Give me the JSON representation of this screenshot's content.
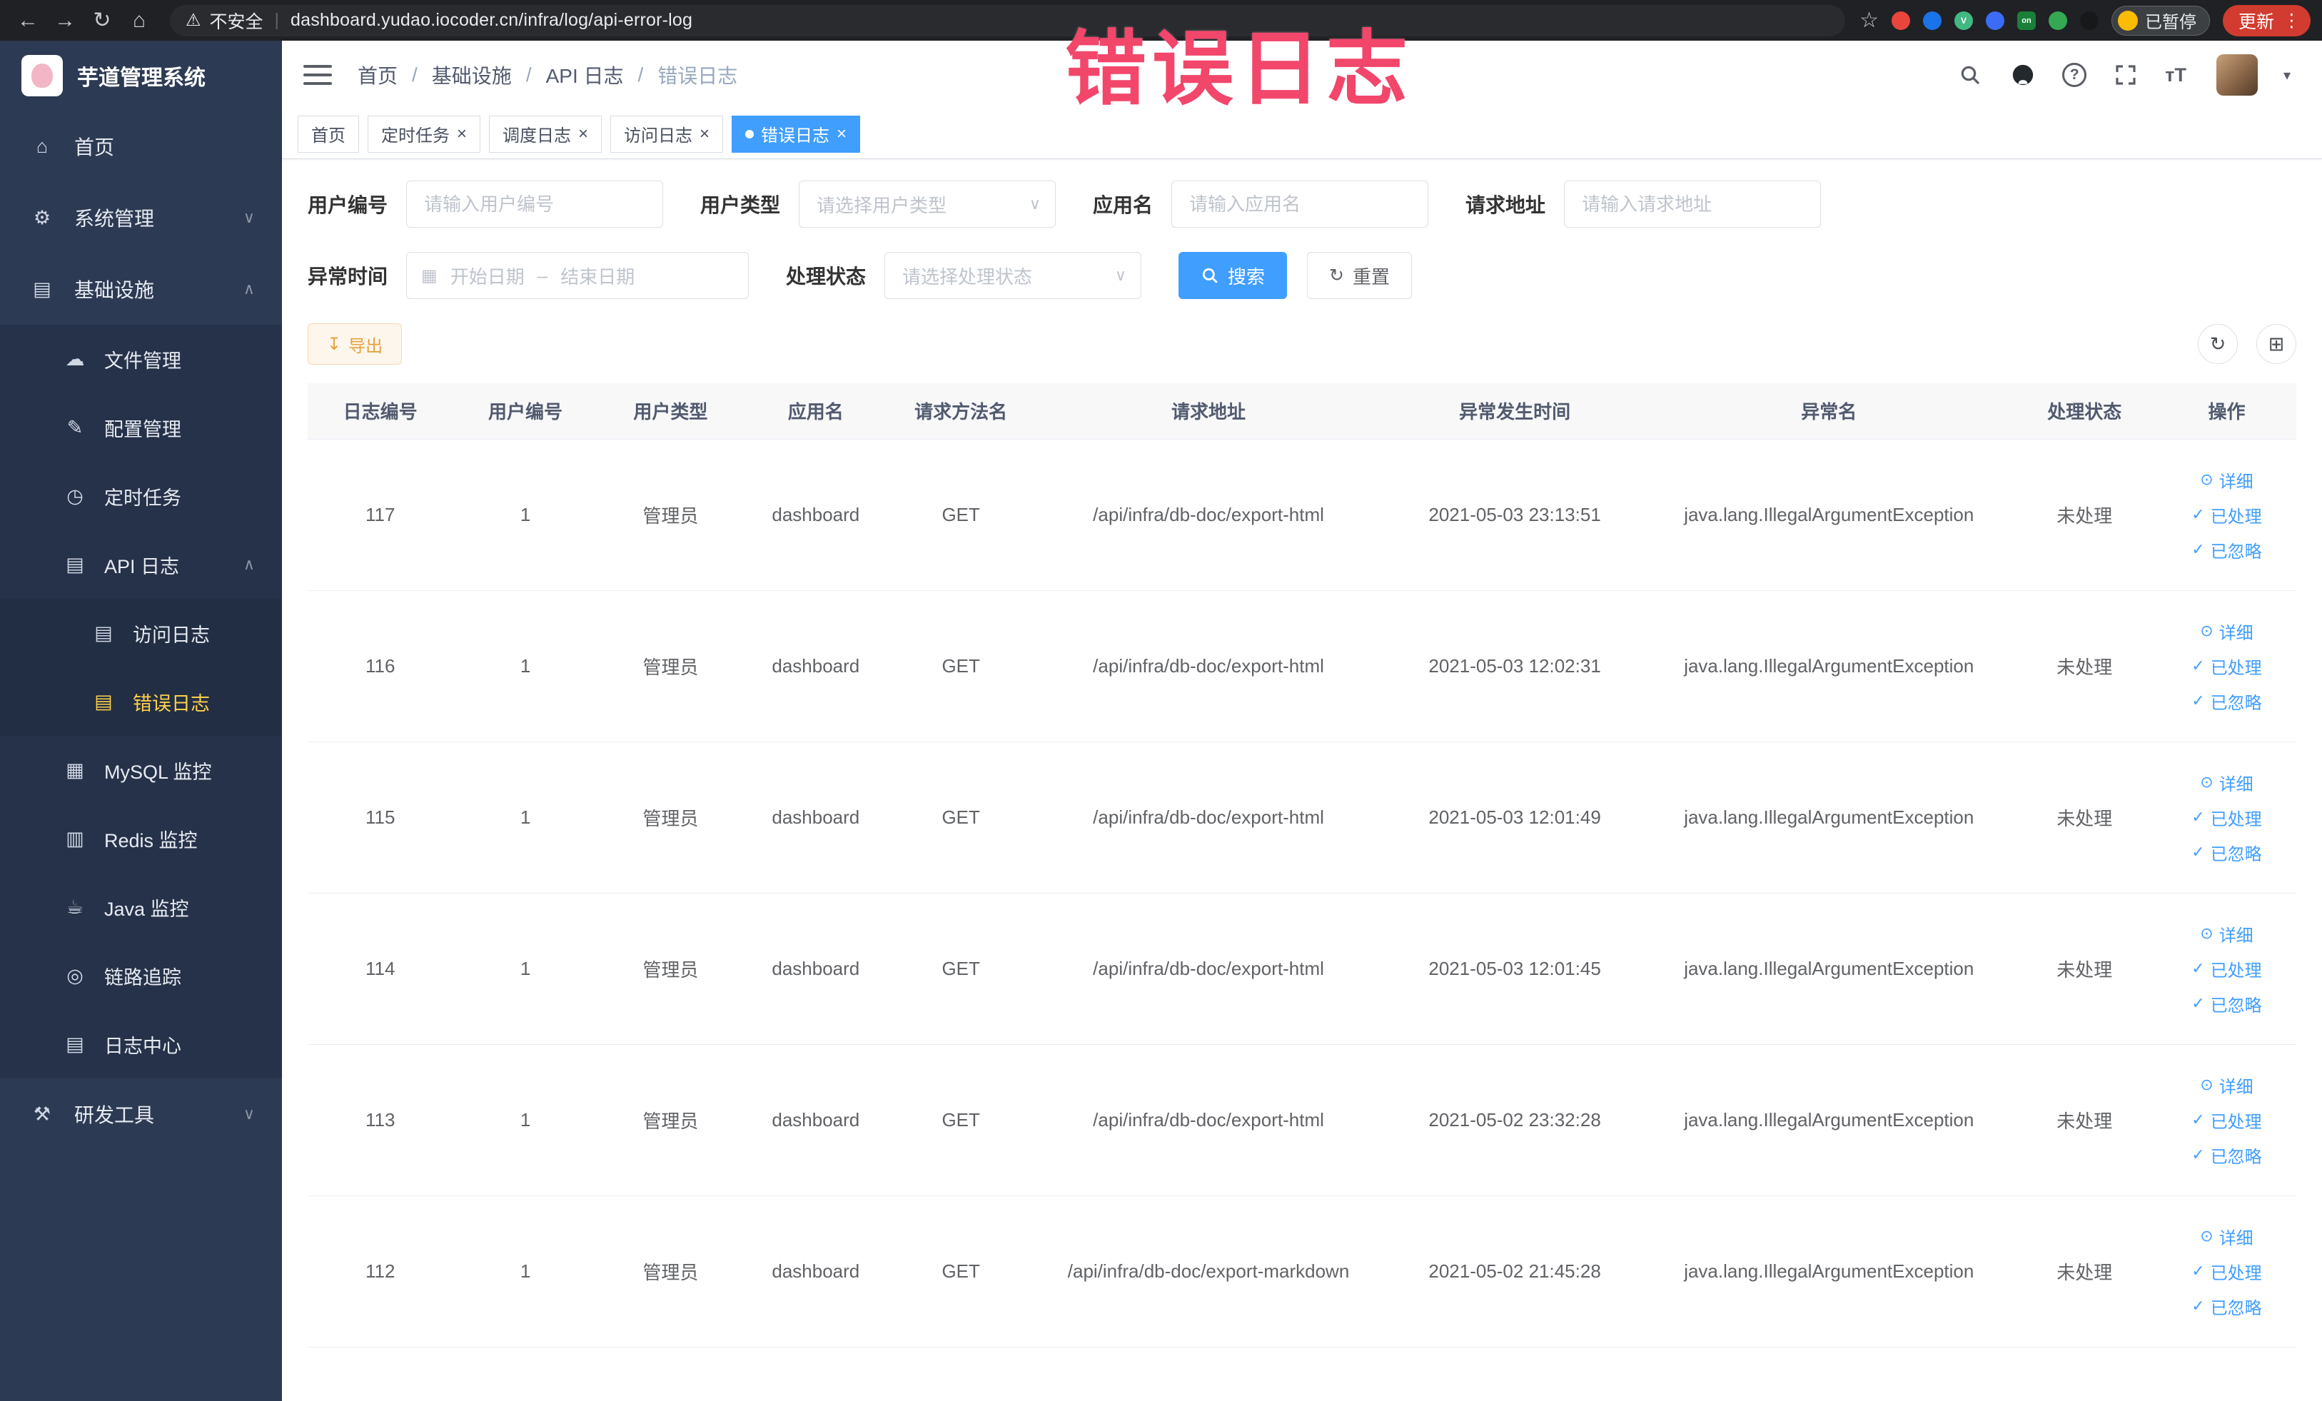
{
  "colors": {
    "primary": "#409eff",
    "annotation": "#f2466b",
    "sidebar_bg": "#2d3a53",
    "active_menu": "#ffd04b",
    "warning": "#e6a23c"
  },
  "browser": {
    "security_label": "不安全",
    "url": "dashboard.yudao.iocoder.cn/infra/log/api-error-log",
    "paused_badge": "已暂停",
    "update_button": "更新"
  },
  "sidebar": {
    "logo_title": "芋道管理系统",
    "home": "首页",
    "system_mgmt": "系统管理",
    "infrastructure": "基础设施",
    "file_mgmt": "文件管理",
    "config_mgmt": "配置管理",
    "scheduled_tasks": "定时任务",
    "api_log": "API 日志",
    "access_log": "访问日志",
    "error_log": "错误日志",
    "mysql_monitor": "MySQL 监控",
    "redis_monitor": "Redis 监控",
    "java_monitor": "Java 监控",
    "trace": "链路追踪",
    "log_center": "日志中心",
    "dev_tools": "研发工具"
  },
  "topbar": {
    "breadcrumb": [
      "首页",
      "基础设施",
      "API 日志",
      "错误日志"
    ],
    "font_icon_label": "тT"
  },
  "tabs": {
    "items": [
      {
        "label": "首页"
      },
      {
        "label": "定时任务"
      },
      {
        "label": "调度日志"
      },
      {
        "label": "访问日志"
      },
      {
        "label": "错误日志"
      }
    ]
  },
  "annotation": {
    "text": "错误日志"
  },
  "filters": {
    "user_id_label": "用户编号",
    "user_id_placeholder": "请输入用户编号",
    "user_type_label": "用户类型",
    "user_type_placeholder": "请选择用户类型",
    "app_name_label": "应用名",
    "app_name_placeholder": "请输入应用名",
    "request_url_label": "请求地址",
    "request_url_placeholder": "请输入请求地址",
    "exception_time_label": "异常时间",
    "start_date_placeholder": "开始日期",
    "end_date_placeholder": "结束日期",
    "range_separator": "–",
    "process_status_label": "处理状态",
    "process_status_placeholder": "请选择处理状态",
    "search_button": "搜索",
    "reset_button": "重置"
  },
  "toolbar": {
    "export_button": "导出"
  },
  "table": {
    "columns": [
      "日志编号",
      "用户编号",
      "用户类型",
      "应用名",
      "请求方法名",
      "请求地址",
      "异常发生时间",
      "异常名",
      "处理状态",
      "操作"
    ],
    "actions": [
      "详细",
      "已处理",
      "已忽略"
    ],
    "rows": [
      {
        "id": "117",
        "user_id": "1",
        "user_type": "管理员",
        "app": "dashboard",
        "method": "GET",
        "url": "/api/infra/db-doc/export-html",
        "time": "2021-05-03 23:13:51",
        "exception": "java.lang.IllegalArgumentException",
        "status": "未处理"
      },
      {
        "id": "116",
        "user_id": "1",
        "user_type": "管理员",
        "app": "dashboard",
        "method": "GET",
        "url": "/api/infra/db-doc/export-html",
        "time": "2021-05-03 12:02:31",
        "exception": "java.lang.IllegalArgumentException",
        "status": "未处理"
      },
      {
        "id": "115",
        "user_id": "1",
        "user_type": "管理员",
        "app": "dashboard",
        "method": "GET",
        "url": "/api/infra/db-doc/export-html",
        "time": "2021-05-03 12:01:49",
        "exception": "java.lang.IllegalArgumentException",
        "status": "未处理"
      },
      {
        "id": "114",
        "user_id": "1",
        "user_type": "管理员",
        "app": "dashboard",
        "method": "GET",
        "url": "/api/infra/db-doc/export-html",
        "time": "2021-05-03 12:01:45",
        "exception": "java.lang.IllegalArgumentException",
        "status": "未处理"
      },
      {
        "id": "113",
        "user_id": "1",
        "user_type": "管理员",
        "app": "dashboard",
        "method": "GET",
        "url": "/api/infra/db-doc/export-html",
        "time": "2021-05-02 23:32:28",
        "exception": "java.lang.IllegalArgumentException",
        "status": "未处理"
      },
      {
        "id": "112",
        "user_id": "1",
        "user_type": "管理员",
        "app": "dashboard",
        "method": "GET",
        "url": "/api/infra/db-doc/export-markdown",
        "time": "2021-05-02 21:45:28",
        "exception": "java.lang.IllegalArgumentException",
        "status": "未处理"
      }
    ]
  },
  "glyphs": {
    "back": "←",
    "forward": "→",
    "reload": "↻",
    "home": "⌂",
    "warning": "⚠",
    "star": "☆",
    "kebab": "⋮",
    "menu_home": "⌂",
    "menu_system": "⚙",
    "menu_infra": "▤",
    "menu_file": "☁",
    "menu_config": "✎",
    "menu_task": "◷",
    "menu_api_log": "▤",
    "menu_doc": "▤",
    "menu_mysql": "▦",
    "menu_redis": "▥",
    "menu_java": "☕",
    "menu_trace": "◎",
    "menu_log_center": "▤",
    "menu_dev": "⚒",
    "chevron_down": "∨",
    "chevron_up": "∧",
    "caret_down": "▾",
    "calendar": "▦",
    "refresh": "↻",
    "grid": "⊞",
    "download": "↧",
    "eye": "⊙",
    "check": "✓",
    "close": "×"
  }
}
